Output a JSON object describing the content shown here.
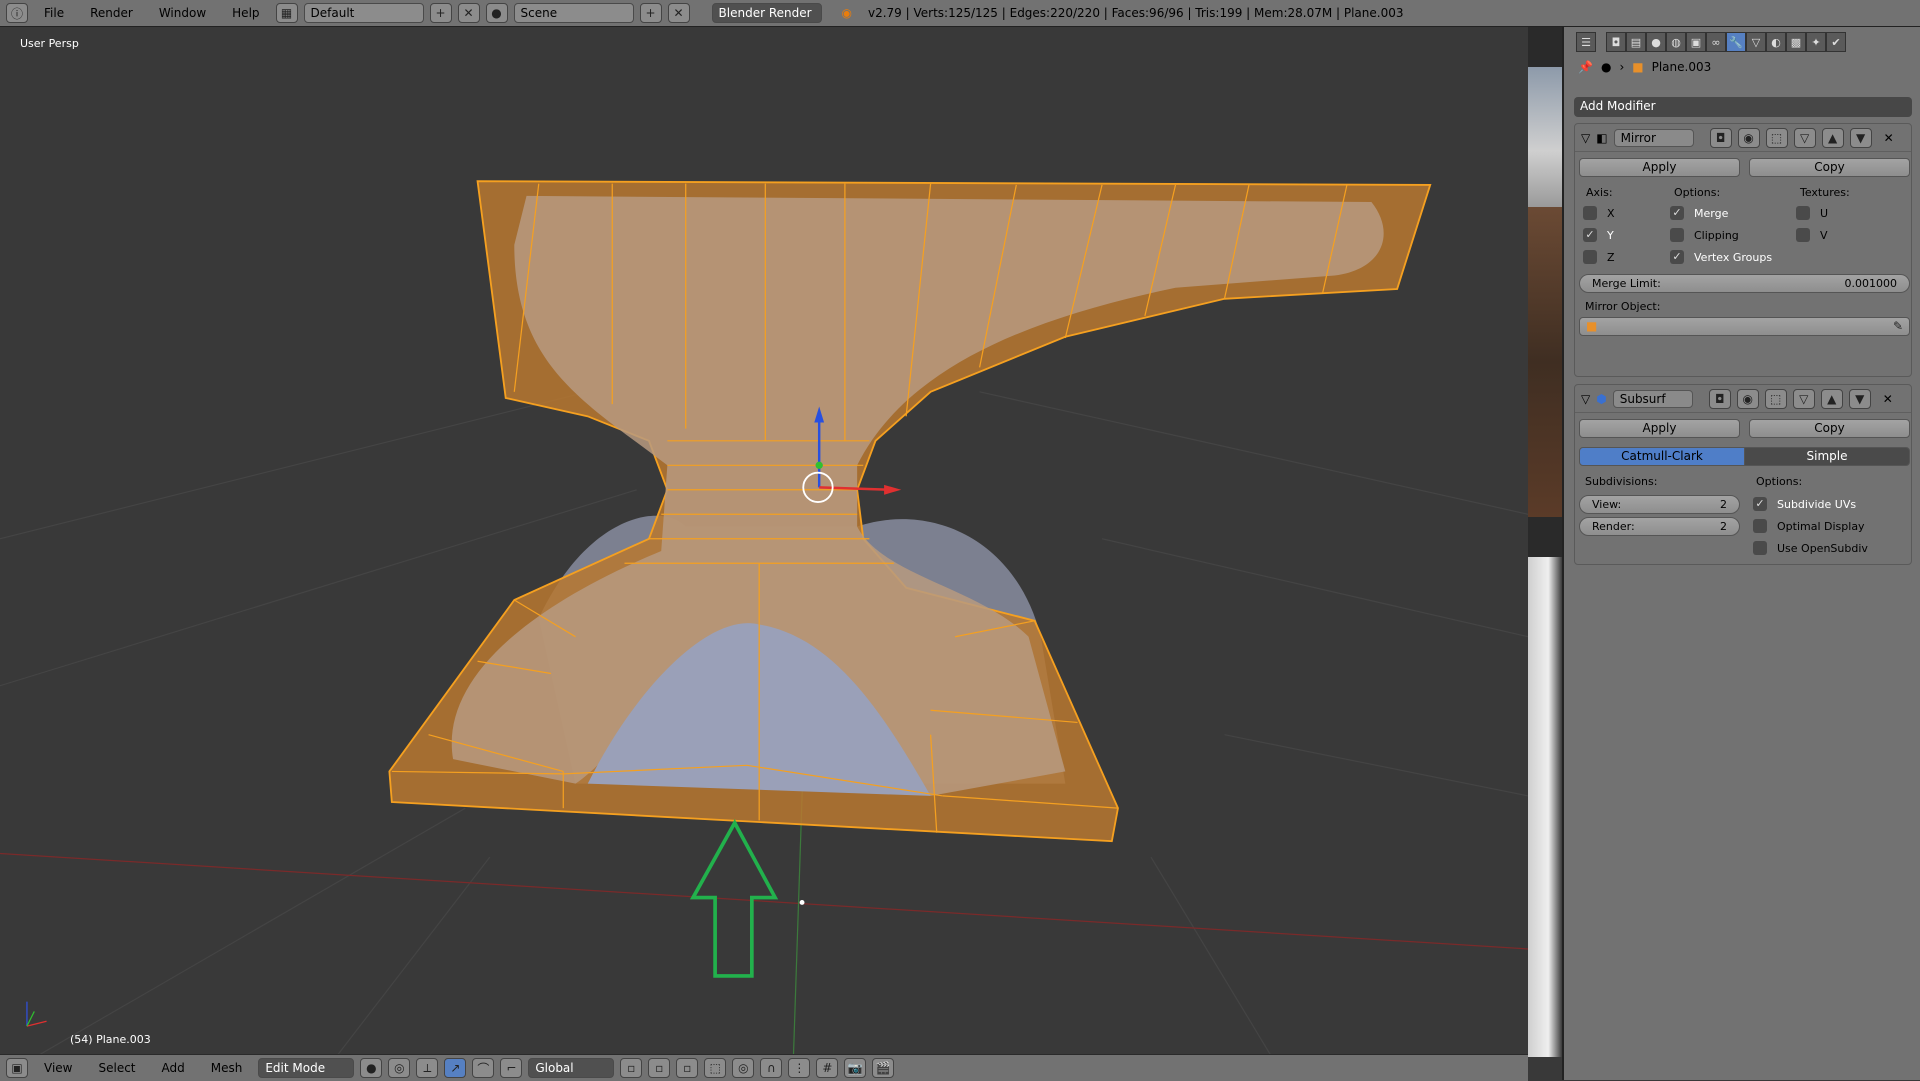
{
  "topbar": {
    "menus": [
      "File",
      "Render",
      "Window",
      "Help"
    ],
    "layout": "Default",
    "scene": "Scene",
    "engine": "Blender Render",
    "stats": "v2.79 | Verts:125/125 | Edges:220/220 | Faces:96/96 | Tris:199 | Mem:28.07M | Plane.003"
  },
  "viewport": {
    "view_label": "User Persp",
    "object_label": "(54) Plane.003",
    "colors": {
      "selection": "#f5a020",
      "annotation_arrow": "#22b14c"
    }
  },
  "bottombar": {
    "menus": [
      "View",
      "Select",
      "Add",
      "Mesh"
    ],
    "mode": "Edit Mode",
    "orientation": "Global"
  },
  "properties": {
    "object": "Plane.003",
    "add_modifier": "Add Modifier",
    "active_tab": "modifiers",
    "mirror": {
      "name": "Mirror",
      "apply": "Apply",
      "copy": "Copy",
      "axis_label": "Axis:",
      "options_label": "Options:",
      "textures_label": "Textures:",
      "axis": [
        {
          "label": "X",
          "checked": false
        },
        {
          "label": "Y",
          "checked": true
        },
        {
          "label": "Z",
          "checked": false
        }
      ],
      "options": [
        {
          "label": "Merge",
          "checked": true
        },
        {
          "label": "Clipping",
          "checked": false
        },
        {
          "label": "Vertex Groups",
          "checked": true
        }
      ],
      "textures": [
        {
          "label": "U",
          "checked": false
        },
        {
          "label": "V",
          "checked": false
        }
      ],
      "merge_limit_label": "Merge Limit:",
      "merge_limit": "0.001000",
      "mirror_object_label": "Mirror Object:"
    },
    "subsurf": {
      "name": "Subsurf",
      "apply": "Apply",
      "copy": "Copy",
      "type_options": [
        "Catmull-Clark",
        "Simple"
      ],
      "selected_type": "Catmull-Clark",
      "subdivisions_label": "Subdivisions:",
      "view_label": "View:",
      "view": "2",
      "render_label": "Render:",
      "render": "2",
      "options_label": "Options:",
      "options": [
        {
          "label": "Subdivide UVs",
          "checked": true
        },
        {
          "label": "Optimal Display",
          "checked": false
        },
        {
          "label": "Use OpenSubdiv",
          "checked": false
        }
      ]
    }
  }
}
